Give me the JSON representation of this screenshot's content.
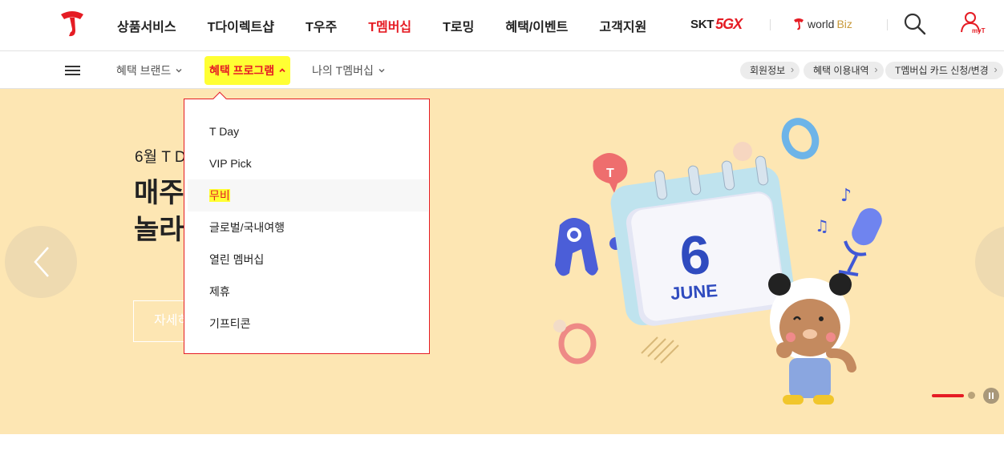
{
  "gnb": {
    "menu": [
      "상품서비스",
      "T다이렉트샵",
      "T우주",
      "T멤버십",
      "T로밍",
      "혜택/이벤트",
      "고객지원"
    ],
    "active_index": 3,
    "skt5gx": {
      "skt": "SKT",
      "g5": "5GX"
    },
    "worldbiz": {
      "world": "world",
      "biz": "Biz"
    },
    "myt_label": "myT",
    "accent": "#e51c24"
  },
  "lnb": {
    "items": [
      "혜택 브랜드",
      "혜택 프로그램",
      "나의 T멤버십"
    ],
    "quick_links": [
      "회원정보",
      "혜택 이용내역",
      "T멤버십 카드 신청/변경"
    ]
  },
  "dropdown": {
    "items": [
      "T Day",
      "VIP Pick",
      "무비",
      "글로벌/국내여행",
      "열린 멤버십",
      "제휴",
      "기프티콘"
    ],
    "hover_index": 2
  },
  "hero": {
    "subtitle": "6월 T D",
    "title_line1": "매주",
    "title_line2": "놀라",
    "button": "자세히",
    "calendar_day": "6",
    "calendar_month": "JUNE",
    "background": "#fde6b3"
  }
}
